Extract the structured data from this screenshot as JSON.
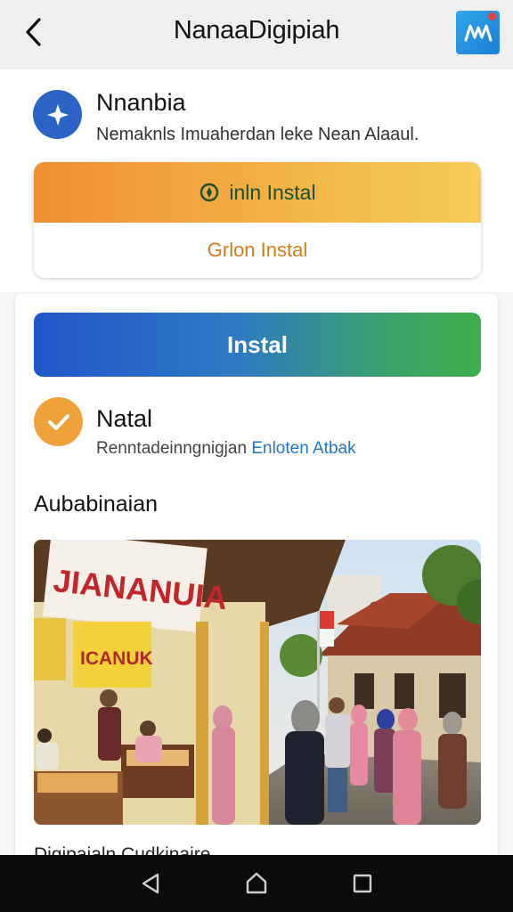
{
  "app_bar": {
    "title": "NanaaDigipiah",
    "back_icon": "chevron-left-icon",
    "logo_icon": "app-logo-icon"
  },
  "app_info": {
    "name": "Nnanbia",
    "description": "Nemaknls Imuaherdan leke Nean Alaaul.",
    "icon": "star-compass-icon"
  },
  "install_options": {
    "primary_label": "inln Instal",
    "secondary_label": "Grlon Instal"
  },
  "main": {
    "install_button_label": "Instal",
    "status": {
      "title": "Natal",
      "description": "Renntadeinngnigjan",
      "link_text": "Enloten Atbak"
    },
    "section_heading": "Aubabinaian",
    "photo": {
      "shop_sign": "JIANANUIA",
      "banner": "ICANUK",
      "description_icon": "market-street-photo"
    },
    "caption": "Digipaialn Cudkinaire"
  },
  "nav_bar": {
    "back": "triangle-back-icon",
    "home": "home-icon",
    "recents": "square-recents-icon"
  },
  "colors": {
    "app_icon": "#2b64c6",
    "install_gradient_start": "#f08e34",
    "install_gradient_end": "#f5cd59",
    "primary_start": "#2057c8",
    "primary_end": "#3fae4d",
    "status_icon": "#efa23a",
    "link": "#2176c8"
  }
}
